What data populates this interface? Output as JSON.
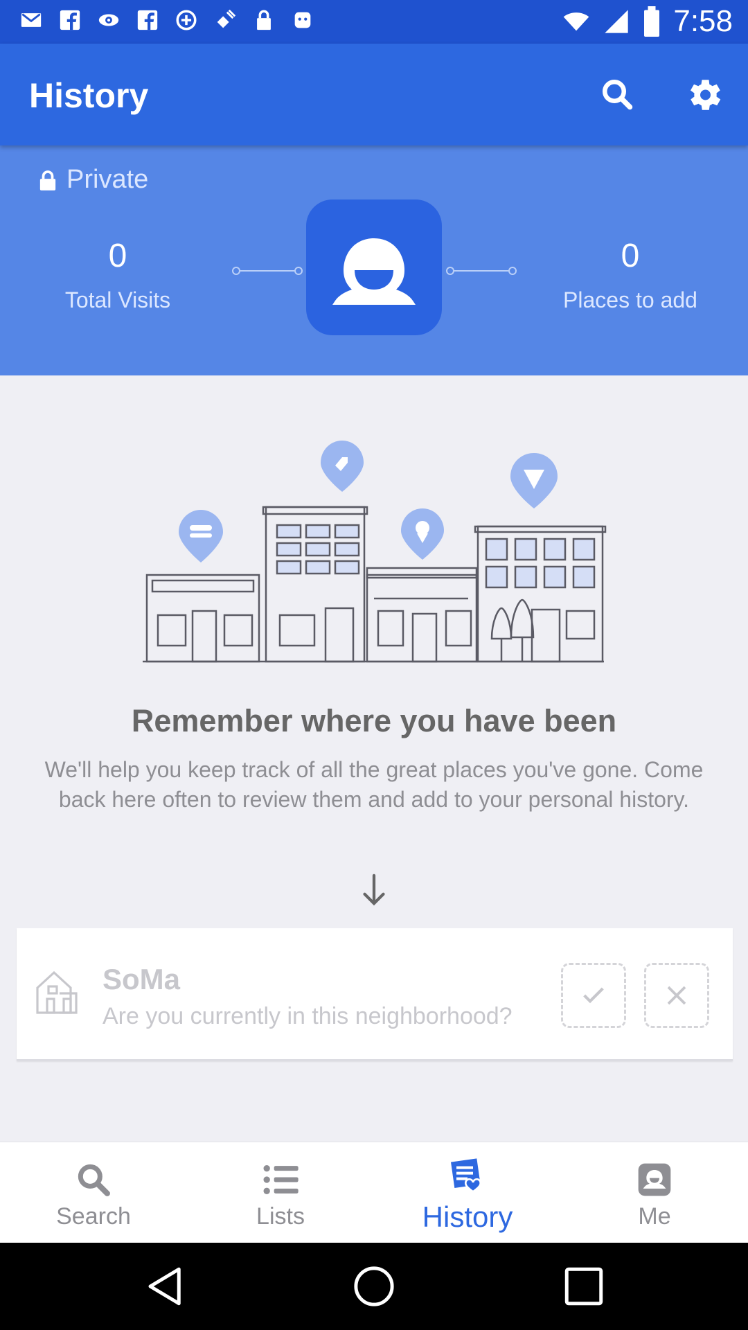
{
  "status_bar": {
    "time": "7:58"
  },
  "app_bar": {
    "title": "History"
  },
  "profile": {
    "privacy_label": "Private",
    "total_visits": {
      "value": "0",
      "label": "Total Visits"
    },
    "places_to_add": {
      "value": "0",
      "label": "Places to add"
    }
  },
  "empty_state": {
    "heading": "Remember where you have been",
    "description": "We'll help you keep track of all the great places you've gone. Come back here often to review them and add to your personal history."
  },
  "neighborhood_card": {
    "name": "SoMa",
    "question": "Are you currently in this neighborhood?"
  },
  "bottom_nav": {
    "items": [
      {
        "label": "Search",
        "icon": "search-icon",
        "active": false
      },
      {
        "label": "Lists",
        "icon": "list-icon",
        "active": false
      },
      {
        "label": "History",
        "icon": "history-icon",
        "active": true
      },
      {
        "label": "Me",
        "icon": "profile-icon",
        "active": false
      }
    ]
  },
  "colors": {
    "status_bar": "#1f52cf",
    "app_bar": "#2d68e0",
    "profile_header": "#5586e6",
    "accent": "#2d68e0",
    "background": "#efeff4"
  }
}
